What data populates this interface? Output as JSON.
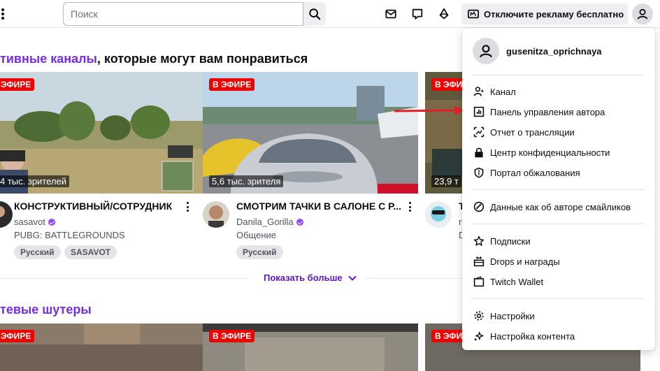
{
  "topbar": {
    "search_placeholder": "Поиск",
    "ad_button_label": "Отключите рекламу бесплатно",
    "icons": [
      "more-vertical-icon",
      "search-icon",
      "inbox-icon",
      "whispers-icon",
      "bits-icon",
      "crown-icon",
      "user-icon"
    ]
  },
  "sections": {
    "recommended_accent": "тивные каналы",
    "recommended_rest": ", которые могут вам понравиться",
    "show_more": "Показать больше",
    "shooters_title": "тевые шутеры"
  },
  "cards": [
    {
      "live_label": "ЭФИРЕ",
      "viewers": "4 тыс. зрителей",
      "title": "КОНСТРУКТИВНЫЙ/СОТРУДНИК",
      "channel": "sasavot",
      "category": "PUBG: BATTLEGROUNDS",
      "tags": [
        "Русский",
        "SASAVOT"
      ]
    },
    {
      "live_label": "В ЭФИРЕ",
      "viewers": "5,6 тыс. зрителя",
      "title": "СМОТРИМ ТАЧКИ В САЛОНЕ С Р...",
      "channel": "Danila_Gorilla",
      "category": "Общение",
      "tags": [
        "Русский"
      ]
    },
    {
      "live_label": "В ЭФИРЕ",
      "viewers": "23,9 т",
      "title": "Т",
      "channel": "r",
      "category": "D",
      "tags": []
    }
  ],
  "bottom_cards": [
    {
      "live_label": "ЭФИРЕ"
    },
    {
      "live_label": "В ЭФИРЕ"
    },
    {
      "live_label": "В ЭФИРЕ"
    }
  ],
  "dropdown": {
    "username": "gusenitza_oprichnaya",
    "groups": [
      [
        {
          "label": "Канал",
          "icon": "channel-icon"
        },
        {
          "label": "Панель управления автора",
          "icon": "dashboard-icon"
        },
        {
          "label": "Отчет о трансляции",
          "icon": "stream-report-icon"
        },
        {
          "label": "Центр конфиденциальности",
          "icon": "lock-icon"
        },
        {
          "label": "Портал обжалования",
          "icon": "shield-icon"
        }
      ],
      [
        {
          "label": "Данные как об авторе смайликов",
          "icon": "emote-data-icon"
        }
      ],
      [
        {
          "label": "Подписки",
          "icon": "star-icon"
        },
        {
          "label": "Drops и награды",
          "icon": "drops-icon"
        },
        {
          "label": "Twitch Wallet",
          "icon": "wallet-icon"
        }
      ],
      [
        {
          "label": "Настройки",
          "icon": "gear-icon"
        },
        {
          "label": "Настройка контента",
          "icon": "sparkle-icon"
        }
      ]
    ]
  },
  "colors": {
    "accent": "#772ce8",
    "live": "#eb0400",
    "annotation_arrow": "#e3202a"
  }
}
